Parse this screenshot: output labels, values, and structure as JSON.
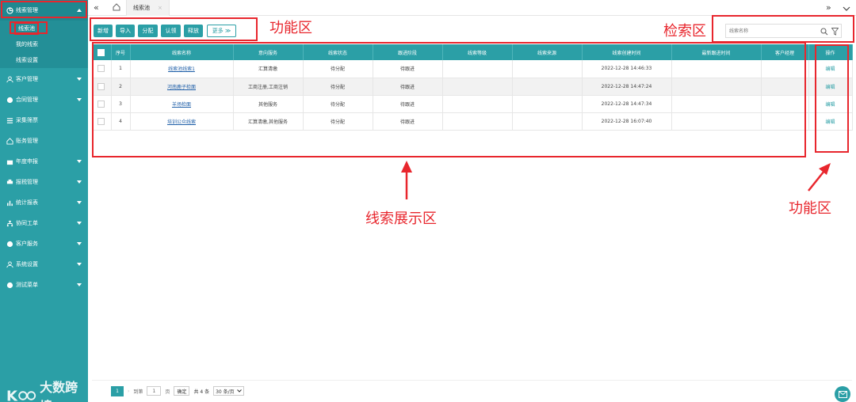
{
  "sidebar": {
    "top_item": "线索管理",
    "sub_items": [
      "线索池",
      "我的线索",
      "线索设置"
    ],
    "items": [
      "客户管理",
      "合同管理",
      "采集筛票",
      "账务管理",
      "年度申报",
      "报税管理",
      "统计报表",
      "协同工单",
      "客户服务",
      "系统设置",
      "测试菜单"
    ],
    "watermark": "大数跨境"
  },
  "tabbar": {
    "tab_label": "线索池",
    "tab_close": "×"
  },
  "toolbar": {
    "buttons": [
      "新增",
      "导入",
      "分配",
      "认领",
      "释放"
    ],
    "more": "更多 ≫"
  },
  "search": {
    "placeholder": "线索名称"
  },
  "annotations": {
    "func_left": "功能区",
    "search_area": "检索区",
    "display_area": "线索展示区",
    "func_right": "功能区"
  },
  "table": {
    "headers": [
      "序号",
      "线索名称",
      "意向服务",
      "线索状态",
      "跟进阶段",
      "线索等级",
      "线索来源",
      "线索创建时间",
      "最新跟进时间",
      "客户经理",
      "操作"
    ],
    "rows": [
      {
        "no": "1",
        "name": "线索池线索1",
        "service": "汇算清缴",
        "status": "待分配",
        "stage": "待跟进",
        "level": "",
        "source": "",
        "created": "2022-12-28 14:46:33",
        "latest": "",
        "manager": "",
        "op": "编辑"
      },
      {
        "no": "2",
        "name": "河南鹿子检面",
        "service": "工商注册,工商注销",
        "status": "待分配",
        "stage": "待跟进",
        "level": "",
        "source": "",
        "created": "2022-12-28 14:47:24",
        "latest": "",
        "manager": "",
        "op": "编辑"
      },
      {
        "no": "3",
        "name": "羊场检面",
        "service": "其他服务",
        "status": "待分配",
        "stage": "待跟进",
        "level": "",
        "source": "",
        "created": "2022-12-28 14:47:34",
        "latest": "",
        "manager": "",
        "op": "编辑"
      },
      {
        "no": "4",
        "name": "培训公众线索",
        "service": "汇算清缴,其他服务",
        "status": "待分配",
        "stage": "待跟进",
        "level": "",
        "source": "",
        "created": "2022-12-28 16:07:40",
        "latest": "",
        "manager": "",
        "op": "编辑"
      }
    ]
  },
  "pager": {
    "current": "1",
    "goto": "到第",
    "input": "1",
    "page": "页",
    "ok": "确定",
    "total": "共 4 条",
    "per_page": "30 条/页"
  },
  "colors": {
    "primary": "#2b9fa6",
    "annotation": "#e8262d"
  }
}
